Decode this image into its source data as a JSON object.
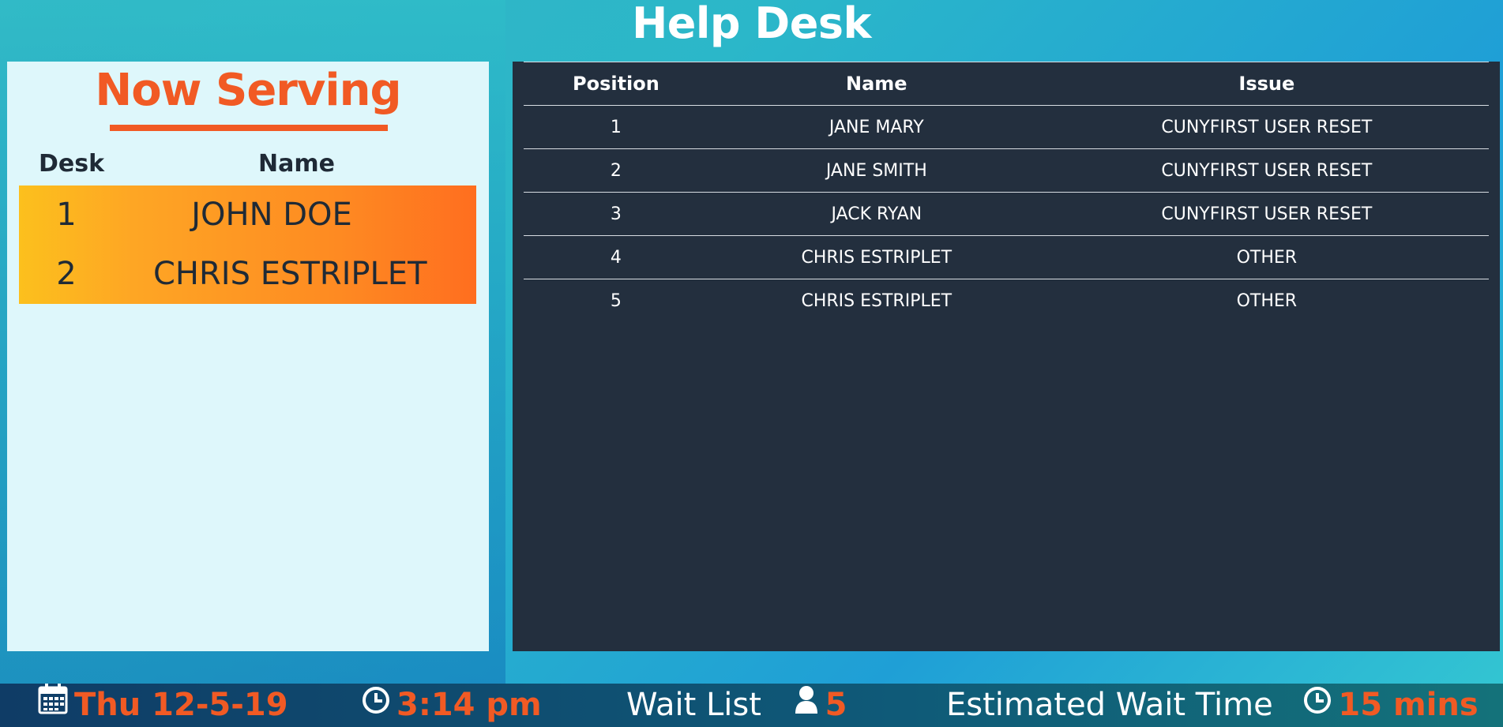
{
  "header": {
    "title": "Help Desk"
  },
  "now_serving": {
    "title": "Now Serving",
    "columns": {
      "desk": "Desk",
      "name": "Name"
    },
    "rows": [
      {
        "desk": "1",
        "name": "JOHN  DOE"
      },
      {
        "desk": "2",
        "name": "CHRIS  ESTRIPLET"
      }
    ]
  },
  "queue": {
    "columns": {
      "position": "Position",
      "name": "Name",
      "issue": "Issue"
    },
    "rows": [
      {
        "position": "1",
        "name": "JANE  MARY",
        "issue": "CUNYFIRST USER RESET"
      },
      {
        "position": "2",
        "name": "JANE  SMITH",
        "issue": "CUNYFIRST USER RESET"
      },
      {
        "position": "3",
        "name": "JACK  RYAN",
        "issue": "CUNYFIRST USER RESET"
      },
      {
        "position": "4",
        "name": "CHRIS  ESTRIPLET",
        "issue": "OTHER"
      },
      {
        "position": "5",
        "name": "CHRIS  ESTRIPLET",
        "issue": "OTHER"
      }
    ]
  },
  "footer": {
    "date": "Thu 12-5-19",
    "time": "3:14 pm",
    "wait_list_label": "Wait List",
    "wait_list_count": "5",
    "estimated_label": "Estimated Wait Time",
    "estimated_value": "15 mins",
    "icons": [
      "calendar-icon",
      "clock-icon",
      "person-icon",
      "clock-icon"
    ]
  },
  "colors": {
    "accent": "#f15a24",
    "panel_dark": "#232f3e",
    "panel_light": "#def7fb"
  }
}
